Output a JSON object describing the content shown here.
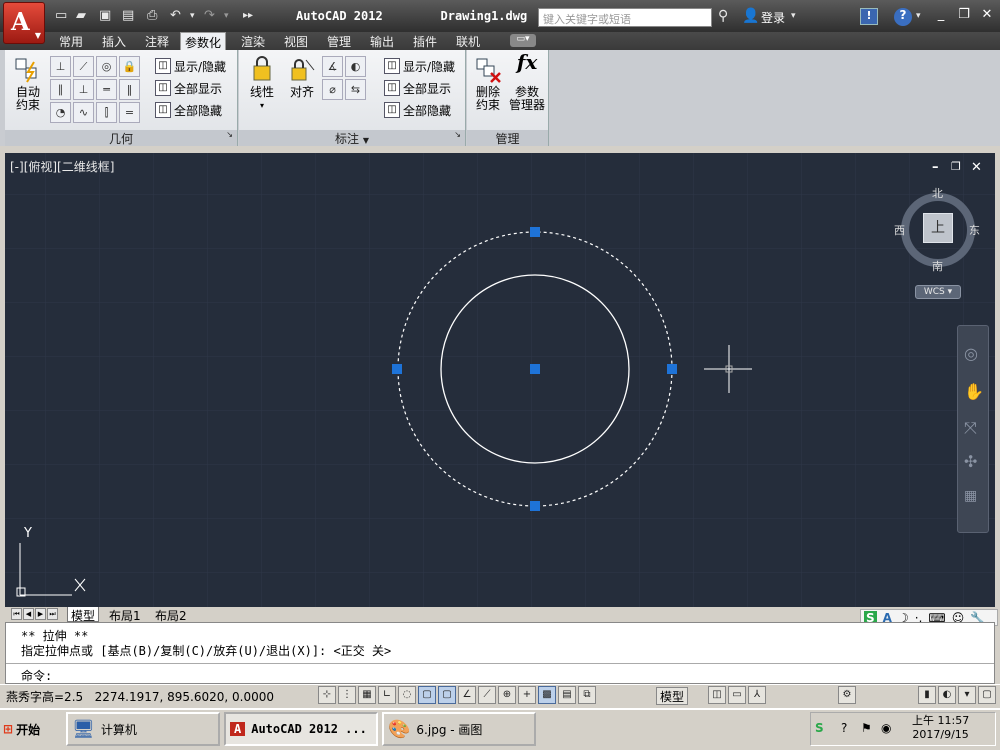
{
  "titlebar": {
    "app_title": "AutoCAD 2012",
    "doc_title": "Drawing1.dwg",
    "search_placeholder": "键入关键字或短语",
    "login_label": "登录"
  },
  "ribbon_tabs": [
    "常用",
    "插入",
    "注释",
    "参数化",
    "渲染",
    "视图",
    "管理",
    "输出",
    "插件",
    "联机"
  ],
  "active_tab": "参数化",
  "panels": {
    "geometry": {
      "title": "几何",
      "auto_constrain_label": "自动\n约束",
      "show_hide": "显示/隐藏",
      "show_all": "全部显示",
      "hide_all": "全部隐藏"
    },
    "dimension": {
      "title": "标注",
      "linear_label": "线性",
      "aligned_label": "对齐",
      "show_hide": "显示/隐藏",
      "show_all": "全部显示",
      "hide_all": "全部隐藏"
    },
    "manage": {
      "title": "管理",
      "delete_constraints_label": "删除\n约束",
      "param_manager_label": "参数\n管理器"
    }
  },
  "viewport": {
    "label": "[-][俯视][二维线框]",
    "viewcube": {
      "north": "北",
      "south": "南",
      "east": "东",
      "west": "西",
      "face": "上",
      "ucs": "WCS"
    },
    "axis_y": "Y",
    "axis_x": "X"
  },
  "layout_tabs": [
    "模型",
    "布局1",
    "布局2"
  ],
  "command": {
    "line1": "** 拉伸 **",
    "line2": "指定拉伸点或 [基点(B)/复制(C)/放弃(U)/退出(X)]:  <正交 关>",
    "line3": "命令:"
  },
  "statusbar": {
    "text_height": "燕秀字高=2.5",
    "coords": "2274.1917, 895.6020, 0.0000",
    "model_label": "模型"
  },
  "taskbar": {
    "start": "开始",
    "tasks": [
      "计算机",
      "AutoCAD 2012 ...",
      "6.jpg - 画图"
    ],
    "time": "上午 11:57",
    "date": "2017/9/15"
  },
  "colors": {
    "canvas_bg": "#252d3b",
    "grip_blue": "#1e73d8",
    "title_bg": "#3c3c3c"
  }
}
